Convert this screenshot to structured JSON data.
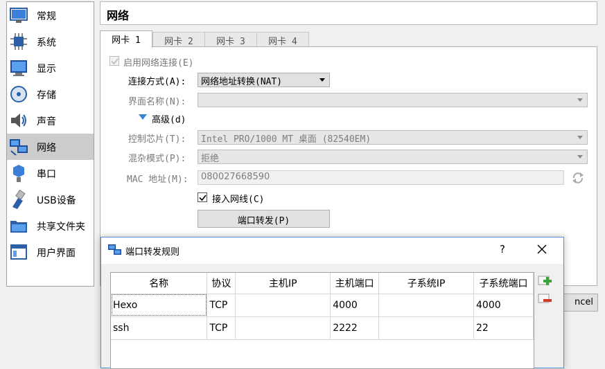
{
  "sidebar": {
    "items": [
      {
        "label": "常规",
        "icon": "general-icon"
      },
      {
        "label": "系统",
        "icon": "system-icon"
      },
      {
        "label": "显示",
        "icon": "display-icon"
      },
      {
        "label": "存储",
        "icon": "storage-icon"
      },
      {
        "label": "声音",
        "icon": "audio-icon"
      },
      {
        "label": "网络",
        "icon": "network-icon",
        "active": true
      },
      {
        "label": "串口",
        "icon": "serial-port-icon"
      },
      {
        "label": "USB设备",
        "icon": "usb-icon"
      },
      {
        "label": "共享文件夹",
        "icon": "shared-folder-icon"
      },
      {
        "label": "用户界面",
        "icon": "user-interface-icon"
      }
    ]
  },
  "page": {
    "title": "网络"
  },
  "tabs": [
    "网卡 1",
    "网卡 2",
    "网卡 3",
    "网卡 4"
  ],
  "form": {
    "enable_label": "启用网络连接(E)",
    "enable_checked": true,
    "attach_label": "连接方式(A):",
    "attach_value": "网络地址转换(NAT)",
    "name_label": "界面名称(N):",
    "name_value": "",
    "advanced_label": "高级(d)",
    "adapter_label": "控制芯片(T):",
    "adapter_value": "Intel PRO/1000 MT 桌面 (82540EM)",
    "promisc_label": "混杂模式(P):",
    "promisc_value": "拒绝",
    "mac_label": "MAC 地址(M):",
    "mac_value": "080027668590",
    "cable_label": "接入网线(C)",
    "cable_checked": true,
    "port_forward_button": "端口转发(P)"
  },
  "dialog": {
    "title": "端口转发规则",
    "help": "?",
    "columns": [
      "名称",
      "协议",
      "主机IP",
      "主机端口",
      "子系统IP",
      "子系统端口"
    ],
    "rows": [
      {
        "name": "Hexo",
        "protocol": "TCP",
        "host_ip": "",
        "host_port": "4000",
        "guest_ip": "",
        "guest_port": "4000"
      },
      {
        "name": "ssh",
        "protocol": "TCP",
        "host_ip": "",
        "host_port": "2222",
        "guest_ip": "",
        "guest_port": "22"
      }
    ]
  },
  "footer": {
    "cancel_partial": "ncel"
  },
  "colors": {
    "accent": "#4a8fd8",
    "active_item": "#cccccc"
  }
}
